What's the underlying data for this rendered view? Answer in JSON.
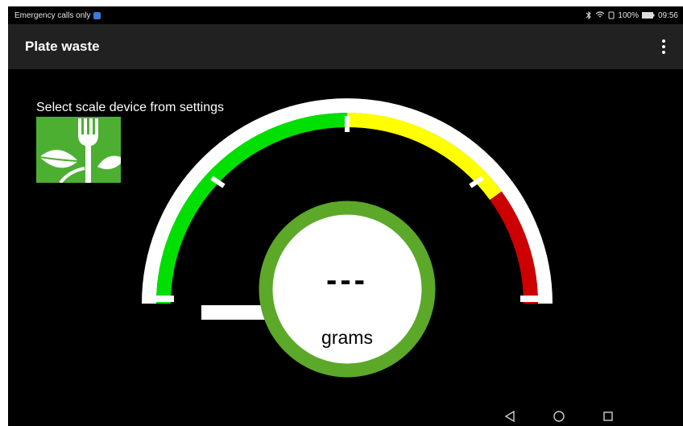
{
  "status_bar": {
    "carrier_text": "Emergency calls only",
    "battery": "100%",
    "time": "09:56",
    "icons": [
      "shield-icon",
      "bluetooth-icon",
      "wifi-icon",
      "sim-icon",
      "battery-icon"
    ]
  },
  "app_bar": {
    "title": "Plate waste",
    "menu_icon": "more-vert-icon"
  },
  "main": {
    "hint": "Select scale device from settings",
    "logo_icon": "fork-leaf-logo",
    "weight_value": "---",
    "weight_unit": "grams",
    "gauge_colors": {
      "green": "#00e000",
      "yellow": "#ffff00",
      "red": "#cc0000",
      "ring": "#5ca828"
    }
  },
  "nav_bar": {
    "back_icon": "back-triangle-icon",
    "home_icon": "home-circle-icon",
    "recents_icon": "recents-square-icon"
  }
}
